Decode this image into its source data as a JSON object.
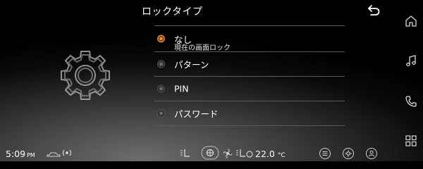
{
  "header": {
    "title": "ロックタイプ",
    "back_icon": "back-arrow-icon"
  },
  "options": [
    {
      "label": "なし",
      "sub": "現在の画面ロック",
      "selected": true
    },
    {
      "label": "パターン",
      "selected": false
    },
    {
      "label": "PIN",
      "selected": false
    },
    {
      "label": "パスワード",
      "selected": false
    }
  ],
  "sidebar": {
    "items": [
      {
        "icon": "home-icon"
      },
      {
        "icon": "music-note-icon"
      },
      {
        "icon": "phone-icon"
      },
      {
        "icon": "apps-grid-icon"
      }
    ]
  },
  "status_bar": {
    "time": "5:09",
    "ampm": "PM",
    "temperature": "22.0",
    "unit": "°C"
  },
  "colors": {
    "accent": "#f0902a",
    "background": "#000000"
  }
}
